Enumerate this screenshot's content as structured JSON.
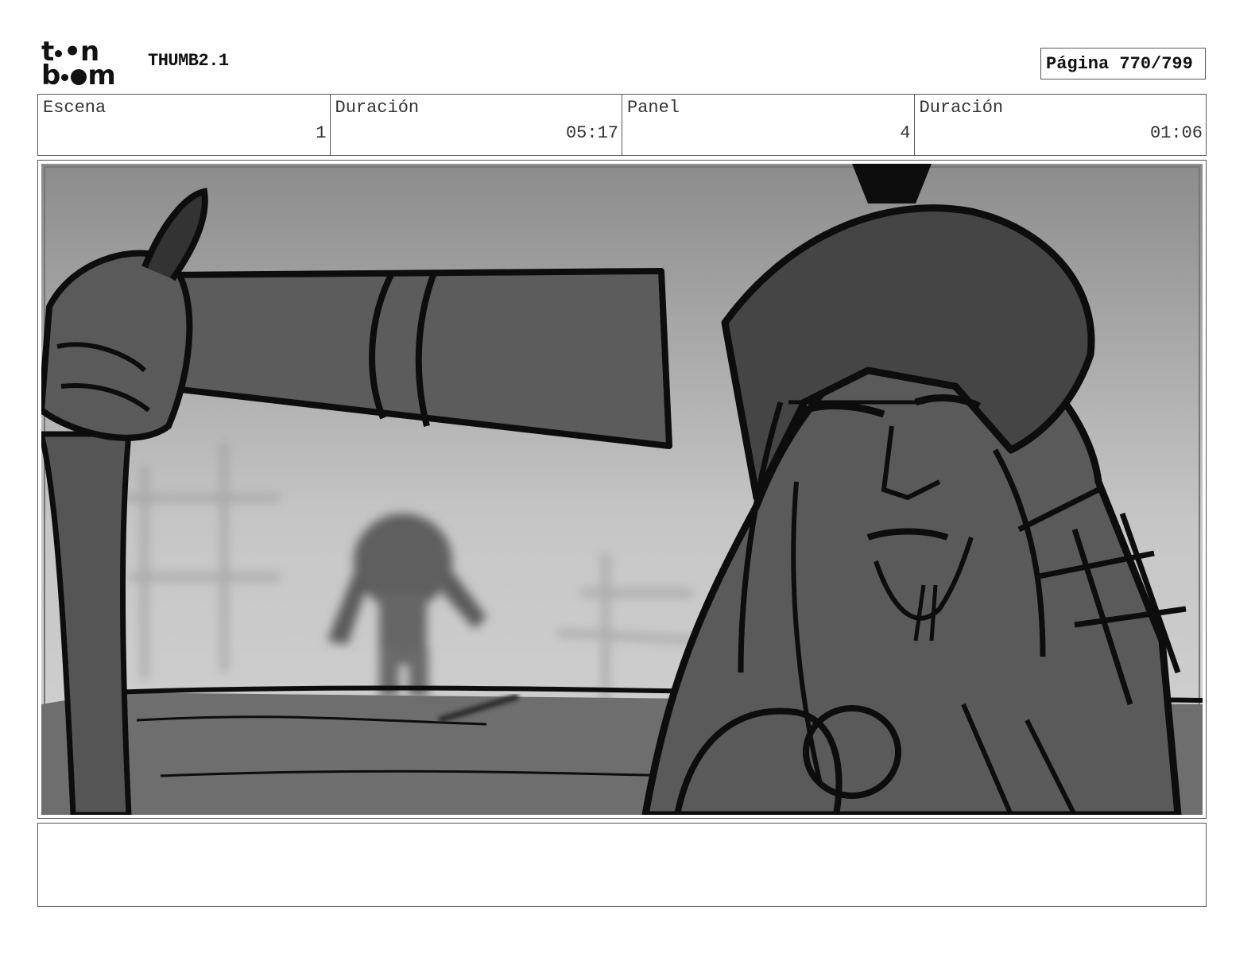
{
  "header": {
    "logo": {
      "line1": "toon",
      "line2": "boom"
    },
    "project": "THUMB2.1",
    "page": "Página 770/799"
  },
  "info": [
    {
      "label": "Escena",
      "value": "1"
    },
    {
      "label": "Duración",
      "value": "05:17"
    },
    {
      "label": "Panel",
      "value": "4"
    },
    {
      "label": "Duración",
      "value": "01:06"
    }
  ],
  "panel": {
    "icon": "storyboard-sketch-image",
    "colors": {
      "sky_top": "#8c8c8c",
      "sky_bottom": "#cfcfcf",
      "figure": "#6a6a6a",
      "ink": "#0d0d0d"
    }
  },
  "notes": {
    "text": ""
  }
}
